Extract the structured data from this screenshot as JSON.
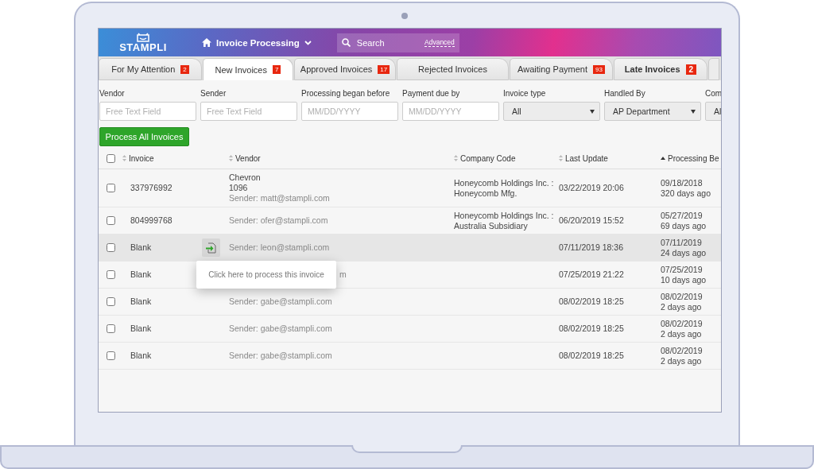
{
  "header": {
    "logo": "STAMPLI",
    "module": "Invoice Processing",
    "search": {
      "placeholder": "Search"
    },
    "advanced": "Advanced"
  },
  "tabs": [
    {
      "label": "For My Attention",
      "badge": "2",
      "selected": false,
      "emphasis": false
    },
    {
      "label": "New Invoices",
      "badge": "7",
      "selected": true,
      "emphasis": false
    },
    {
      "label": "Approved Invoices",
      "badge": "17",
      "selected": false,
      "emphasis": false
    },
    {
      "label": "Rejected Invoices",
      "selected": false,
      "emphasis": false
    },
    {
      "label": "Awaiting Payment",
      "badge": "93",
      "selected": false,
      "emphasis": false
    },
    {
      "label": "Late Invoices",
      "badge": "2",
      "selected": false,
      "emphasis": true
    }
  ],
  "filters": [
    {
      "label": "Vendor",
      "kind": "text",
      "placeholder": "Free Text Field"
    },
    {
      "label": "Sender",
      "kind": "text",
      "placeholder": "Free Text Field"
    },
    {
      "label": "Processing began before",
      "kind": "text",
      "placeholder": "MM/DD/YYYY"
    },
    {
      "label": "Payment due by",
      "kind": "text",
      "placeholder": "MM/DD/YYYY"
    },
    {
      "label": "Invoice type",
      "kind": "select",
      "value": "All"
    },
    {
      "label": "Handled By",
      "kind": "select",
      "value": "AP Department"
    },
    {
      "label": "Com",
      "kind": "cut",
      "value": "Al"
    }
  ],
  "action_button": "Process All Invoices",
  "table": {
    "select_all": {
      "checked": false
    },
    "columns": [
      {
        "label": "Invoice",
        "sorted": false
      },
      {
        "label": "Vendor",
        "sorted": false
      },
      {
        "label": "Company Code",
        "sorted": false
      },
      {
        "label": "Last Update",
        "sorted": false
      },
      {
        "label": "Processing Be",
        "sorted": true
      }
    ],
    "rows": [
      {
        "checked": false,
        "hovered": false,
        "invoice": "337976992",
        "vendor": [
          "Chevron",
          "1096"
        ],
        "sender": "Sender: matt@stampli.com",
        "company_code": [
          "Honeycomb Holdings Inc. :",
          "Honeycomb Mfg."
        ],
        "last_update": "03/22/2019 20:06",
        "processing_date": "09/18/2018",
        "processing_age": "320 days ago"
      },
      {
        "checked": false,
        "hovered": false,
        "invoice": "804999768",
        "sender": "Sender: ofer@stampli.com",
        "company_code": [
          "Honeycomb Holdings Inc. :",
          "Australia Subsidiary"
        ],
        "last_update": "06/20/2019 15:52",
        "processing_date": "05/27/2019",
        "processing_age": "69 days ago"
      },
      {
        "checked": false,
        "hovered": true,
        "invoice": "Blank",
        "sender": "Sender: leon@stampli.com",
        "last_update": "07/11/2019 18:36",
        "processing_date": "07/11/2019",
        "processing_age": "24 days ago"
      },
      {
        "checked": false,
        "hovered": false,
        "invoice": "Blank",
        "sender_tail": "m",
        "last_update": "07/25/2019 21:22",
        "processing_date": "07/25/2019",
        "processing_age": "10 days ago"
      },
      {
        "checked": false,
        "hovered": false,
        "invoice": "Blank",
        "sender": "Sender: gabe@stampli.com",
        "last_update": "08/02/2019 18:25",
        "processing_date": "08/02/2019",
        "processing_age": "2 days ago"
      },
      {
        "checked": false,
        "hovered": false,
        "invoice": "Blank",
        "sender": "Sender: gabe@stampli.com",
        "last_update": "08/02/2019 18:25",
        "processing_date": "08/02/2019",
        "processing_age": "2 days ago"
      },
      {
        "checked": false,
        "hovered": false,
        "invoice": "Blank",
        "sender": "Sender: gabe@stampli.com",
        "last_update": "08/02/2019 18:25",
        "processing_date": "08/02/2019",
        "processing_age": "2 days ago"
      }
    ]
  },
  "tooltip": {
    "text": "Click here to process this invoice"
  }
}
